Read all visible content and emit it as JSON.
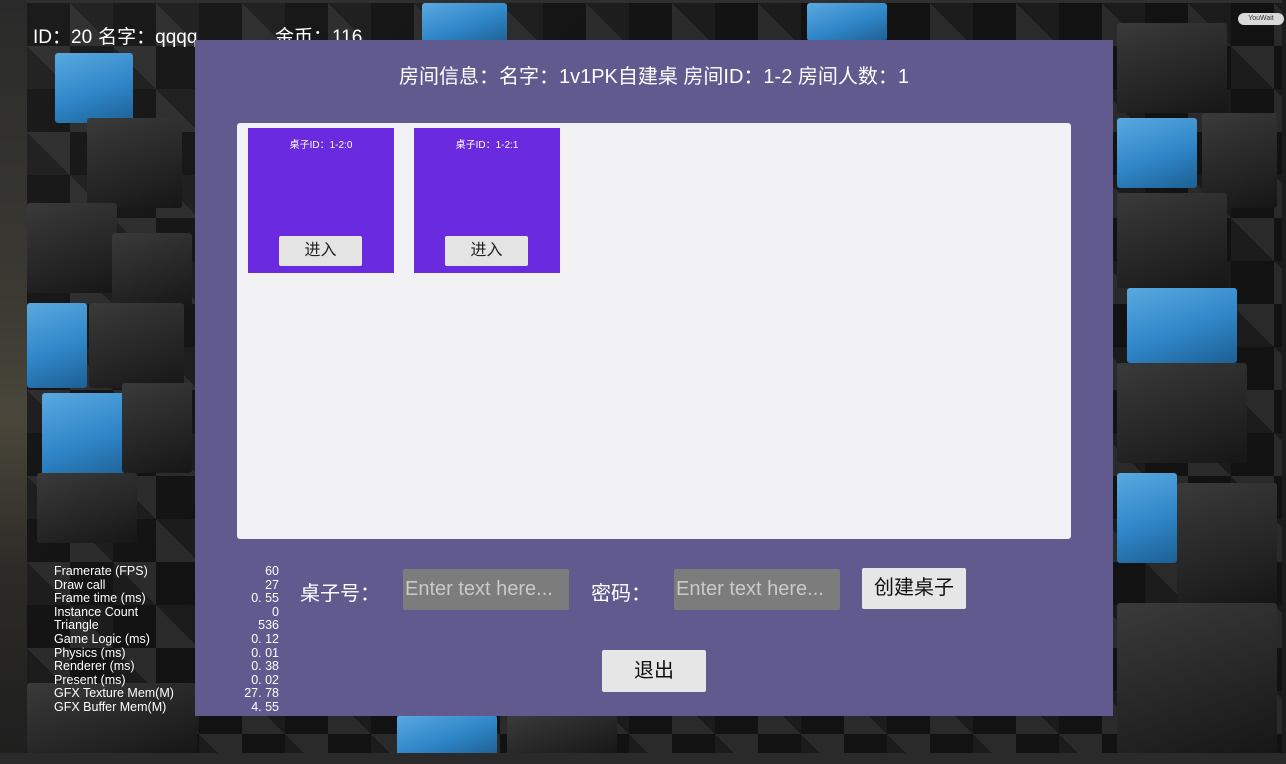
{
  "player": {
    "id_text": "ID：20",
    "name_text": "名字：qqqq",
    "coins_text": "金币：116"
  },
  "corner_button": {
    "label": "YouWait"
  },
  "room": {
    "title": "房间信息：名字：1v1PK自建桌 房间ID：1-2 房间人数：1",
    "tables": [
      {
        "id_text": "桌子ID：1-2:0",
        "enter_label": "进入"
      },
      {
        "id_text": "桌子ID：1-2:1",
        "enter_label": "进入"
      }
    ]
  },
  "create_form": {
    "table_no_label": "桌子号：",
    "table_no_placeholder": "Enter text here...",
    "password_label": "密码：",
    "password_placeholder": "Enter text here...",
    "create_label": "创建桌子"
  },
  "exit_label": "退出",
  "stats": [
    {
      "name": "Framerate (FPS)",
      "value": "60"
    },
    {
      "name": "Draw call",
      "value": "27"
    },
    {
      "name": "Frame time (ms)",
      "value": "0. 55"
    },
    {
      "name": "Instance Count",
      "value": "0"
    },
    {
      "name": "Triangle",
      "value": "536"
    },
    {
      "name": "Game Logic (ms)",
      "value": "0. 12"
    },
    {
      "name": "Physics (ms)",
      "value": "0. 01"
    },
    {
      "name": "Renderer (ms)",
      "value": "0. 38"
    },
    {
      "name": "Present (ms)",
      "value": "0. 02"
    },
    {
      "name": "GFX Texture Mem(M)",
      "value": "27. 78"
    },
    {
      "name": "GFX Buffer Mem(M)",
      "value": "4. 55"
    }
  ]
}
